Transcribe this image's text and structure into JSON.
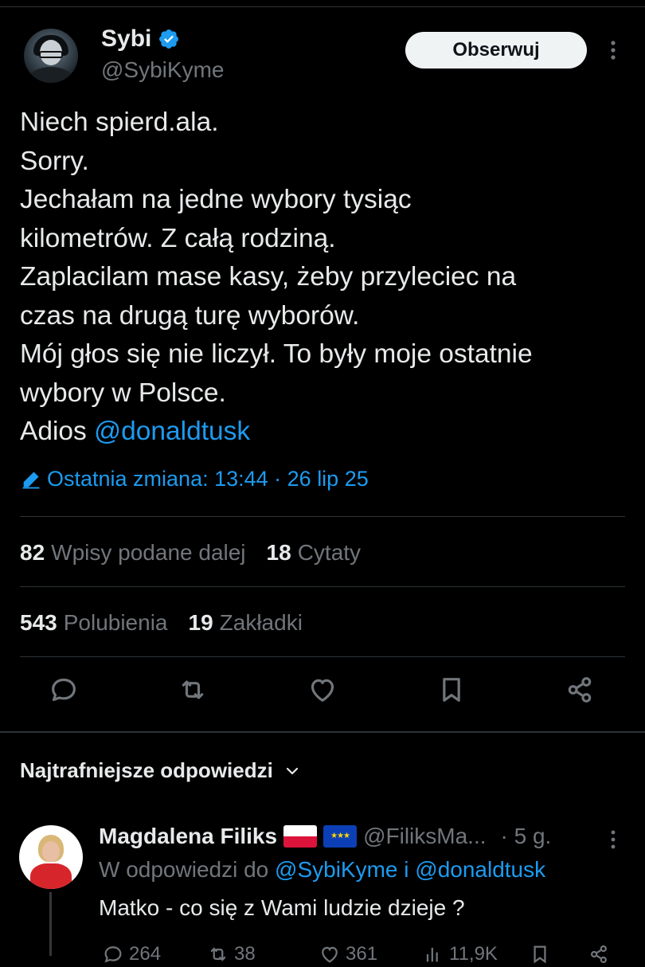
{
  "tweet": {
    "author_name": "Sybi",
    "author_handle": "@SybiKyme",
    "follow_label": "Obserwuj",
    "text_lines": [
      "Niech spierd.ala.",
      "Sorry.",
      "Jechałam na jedne wybory tysiąc",
      "kilometrów. Z całą rodziną.",
      "Zaplacilam mase kasy, żeby przyleciec na",
      "czas na drugą turę wyborów.",
      "Mój głos się nie liczył. To były moje ostatnie",
      "wybory w Polsce."
    ],
    "last_line_prefix": "Adios ",
    "last_line_mention": "@donaldtusk",
    "edited_label": "Ostatnia zmiana: 13:44 · 26 lip 25"
  },
  "stats": {
    "reposts_count": "82",
    "reposts_label": "Wpisy podane dalej",
    "quotes_count": "18",
    "quotes_label": "Cytaty",
    "likes_count": "543",
    "likes_label": "Polubienia",
    "bookmarks_count": "19",
    "bookmarks_label": "Zakładki"
  },
  "actions": {
    "icons": [
      "reply-icon",
      "repost-icon",
      "like-icon",
      "bookmark-icon",
      "share-icon"
    ]
  },
  "replies_section": {
    "sort_label": "Najtrafniejsze odpowiedzi"
  },
  "reply": {
    "author_name": "Magdalena Filiks",
    "author_handle": "@FiliksMa...",
    "time": "· 5 g.",
    "replying_to_prefix": "W odpowiedzi do ",
    "replying_to_user1": "@SybiKyme",
    "replying_to_join": " i ",
    "replying_to_user2": "@donaldtusk",
    "text": "Matko - co się z Wami ludzie dzieje ?",
    "reply_count": "264",
    "repost_count": "38",
    "like_count": "361",
    "views_count": "11,9K"
  },
  "colors": {
    "background": "#000000",
    "accent": "#1d9bf0",
    "text": "#e7e9ea",
    "muted": "#71767b",
    "divider": "#2f3336"
  }
}
